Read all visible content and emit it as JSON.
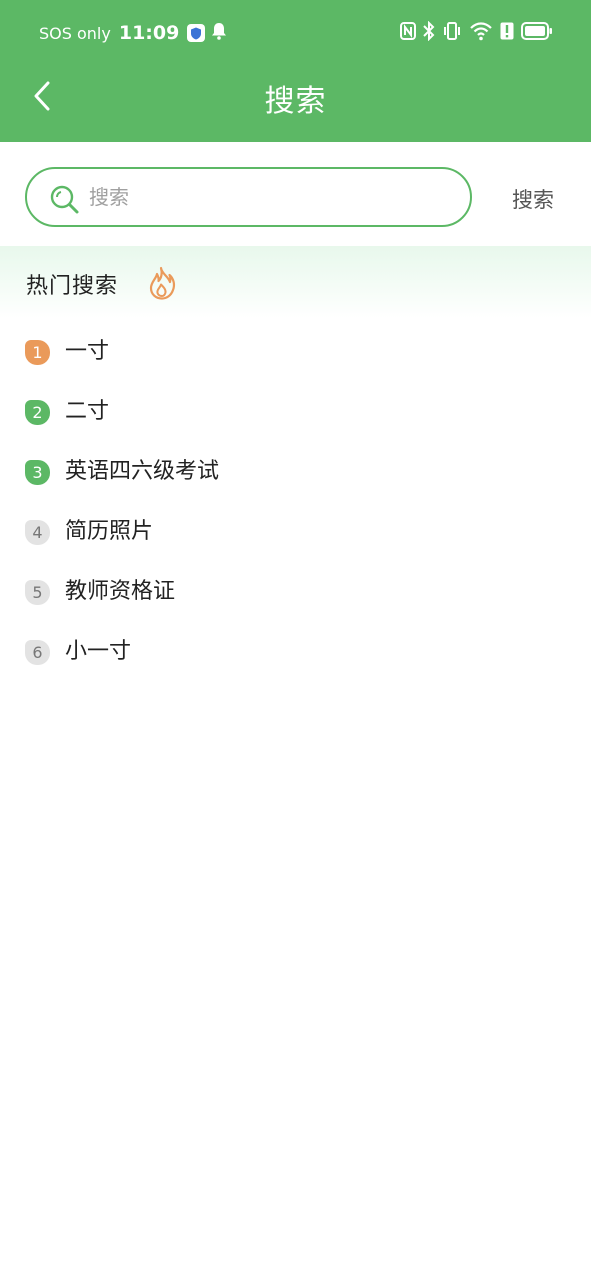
{
  "status_bar": {
    "carrier": "SOS only",
    "time": "11:09",
    "icons": [
      "shield-icon",
      "bell-icon",
      "nfc-icon",
      "bluetooth-icon",
      "vibrate-icon",
      "wifi-icon",
      "alert-icon",
      "battery-icon"
    ]
  },
  "header": {
    "title": "搜索",
    "back_icon": "chevron-left-icon"
  },
  "search": {
    "placeholder": "搜索",
    "value": "",
    "button_label": "搜索"
  },
  "hot": {
    "title": "热门搜索",
    "icon": "flame-icon",
    "items": [
      {
        "rank": "1",
        "label": "一寸"
      },
      {
        "rank": "2",
        "label": "二寸"
      },
      {
        "rank": "3",
        "label": "英语四六级考试"
      },
      {
        "rank": "4",
        "label": "简历照片"
      },
      {
        "rank": "5",
        "label": "教师资格证"
      },
      {
        "rank": "6",
        "label": "小一寸"
      }
    ]
  },
  "colors": {
    "brand_green": "#5cb865",
    "rank_orange": "#ea9a5a",
    "rank_gray": "#e3e3e3",
    "hot_header_bg": "#e8f8ec"
  }
}
